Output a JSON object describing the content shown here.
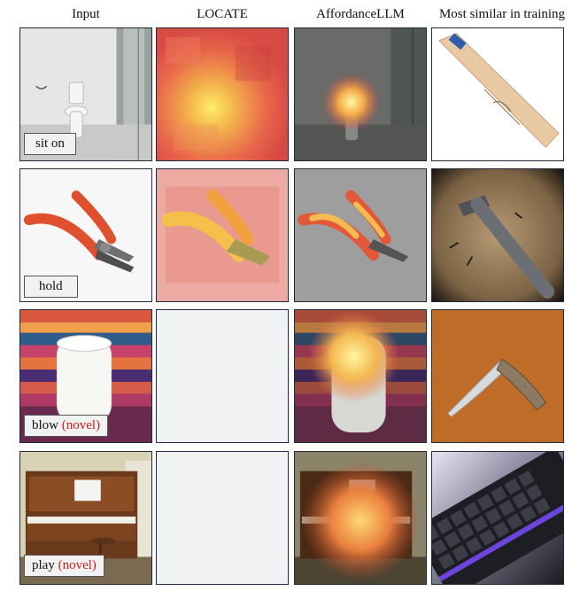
{
  "columns": [
    "Input",
    "LOCATE",
    "AffordanceLLM",
    "Most similar in training"
  ],
  "rows": [
    {
      "label": "sit on",
      "novel": ""
    },
    {
      "label": "hold",
      "novel": ""
    },
    {
      "label": "blow",
      "novel": "(novel)"
    },
    {
      "label": "play",
      "novel": "(novel)"
    }
  ],
  "colors": {
    "novel": "#d41c1c",
    "border": "#1f2a3a",
    "placeholder": "#f1f2f4"
  }
}
